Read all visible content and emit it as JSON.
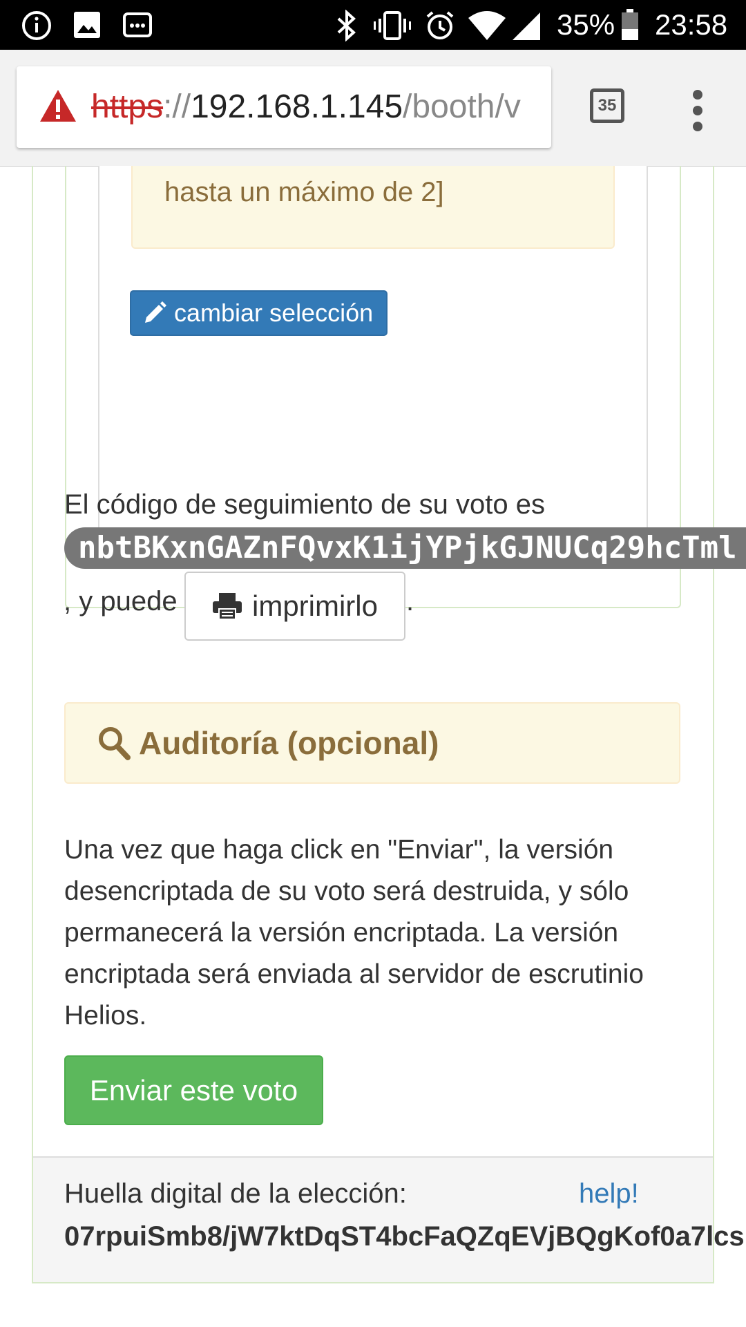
{
  "status_bar": {
    "time": "23:58",
    "battery_percent": "35%"
  },
  "browser": {
    "url": {
      "scheme": "https",
      "separator": "://",
      "host": "192.168.1.145",
      "path": "/booth/v"
    },
    "tab_count": "35"
  },
  "choice": {
    "warning_text": "hasta un máximo de 2]",
    "change_button_label": "cambiar selección"
  },
  "tracker": {
    "intro": "El código de seguimiento de su voto es",
    "code": "nbtBKxnGAZnFQvxK1ijYPjkGJNUCq29hcTml",
    "and_can": ", y puede",
    "print_label": "imprimirlo",
    "period": "."
  },
  "audit": {
    "title": "Auditoría (opcional)"
  },
  "submit": {
    "explanation": "Una vez que haga click en \"Enviar\", la versión desencriptada de su voto será destruida, y sólo permanecerá la versión encriptada. La versión encriptada será enviada al servidor de escrutinio Helios.",
    "button_label": "Enviar este voto"
  },
  "footer": {
    "fingerprint_label": "Huella digital de la elección:",
    "help_label": "help!",
    "fingerprint_value": "07rpuiSmb8/jW7ktDqST4bcFaQZqEVjBQgKof0a7lcs"
  },
  "colors": {
    "primary": "#337ab7",
    "success": "#5cb85c",
    "warning_bg": "#fcf8e3",
    "warning_text": "#8a6d3b",
    "panel_border": "#d6e9c6",
    "url_scheme_red": "#c62828"
  }
}
